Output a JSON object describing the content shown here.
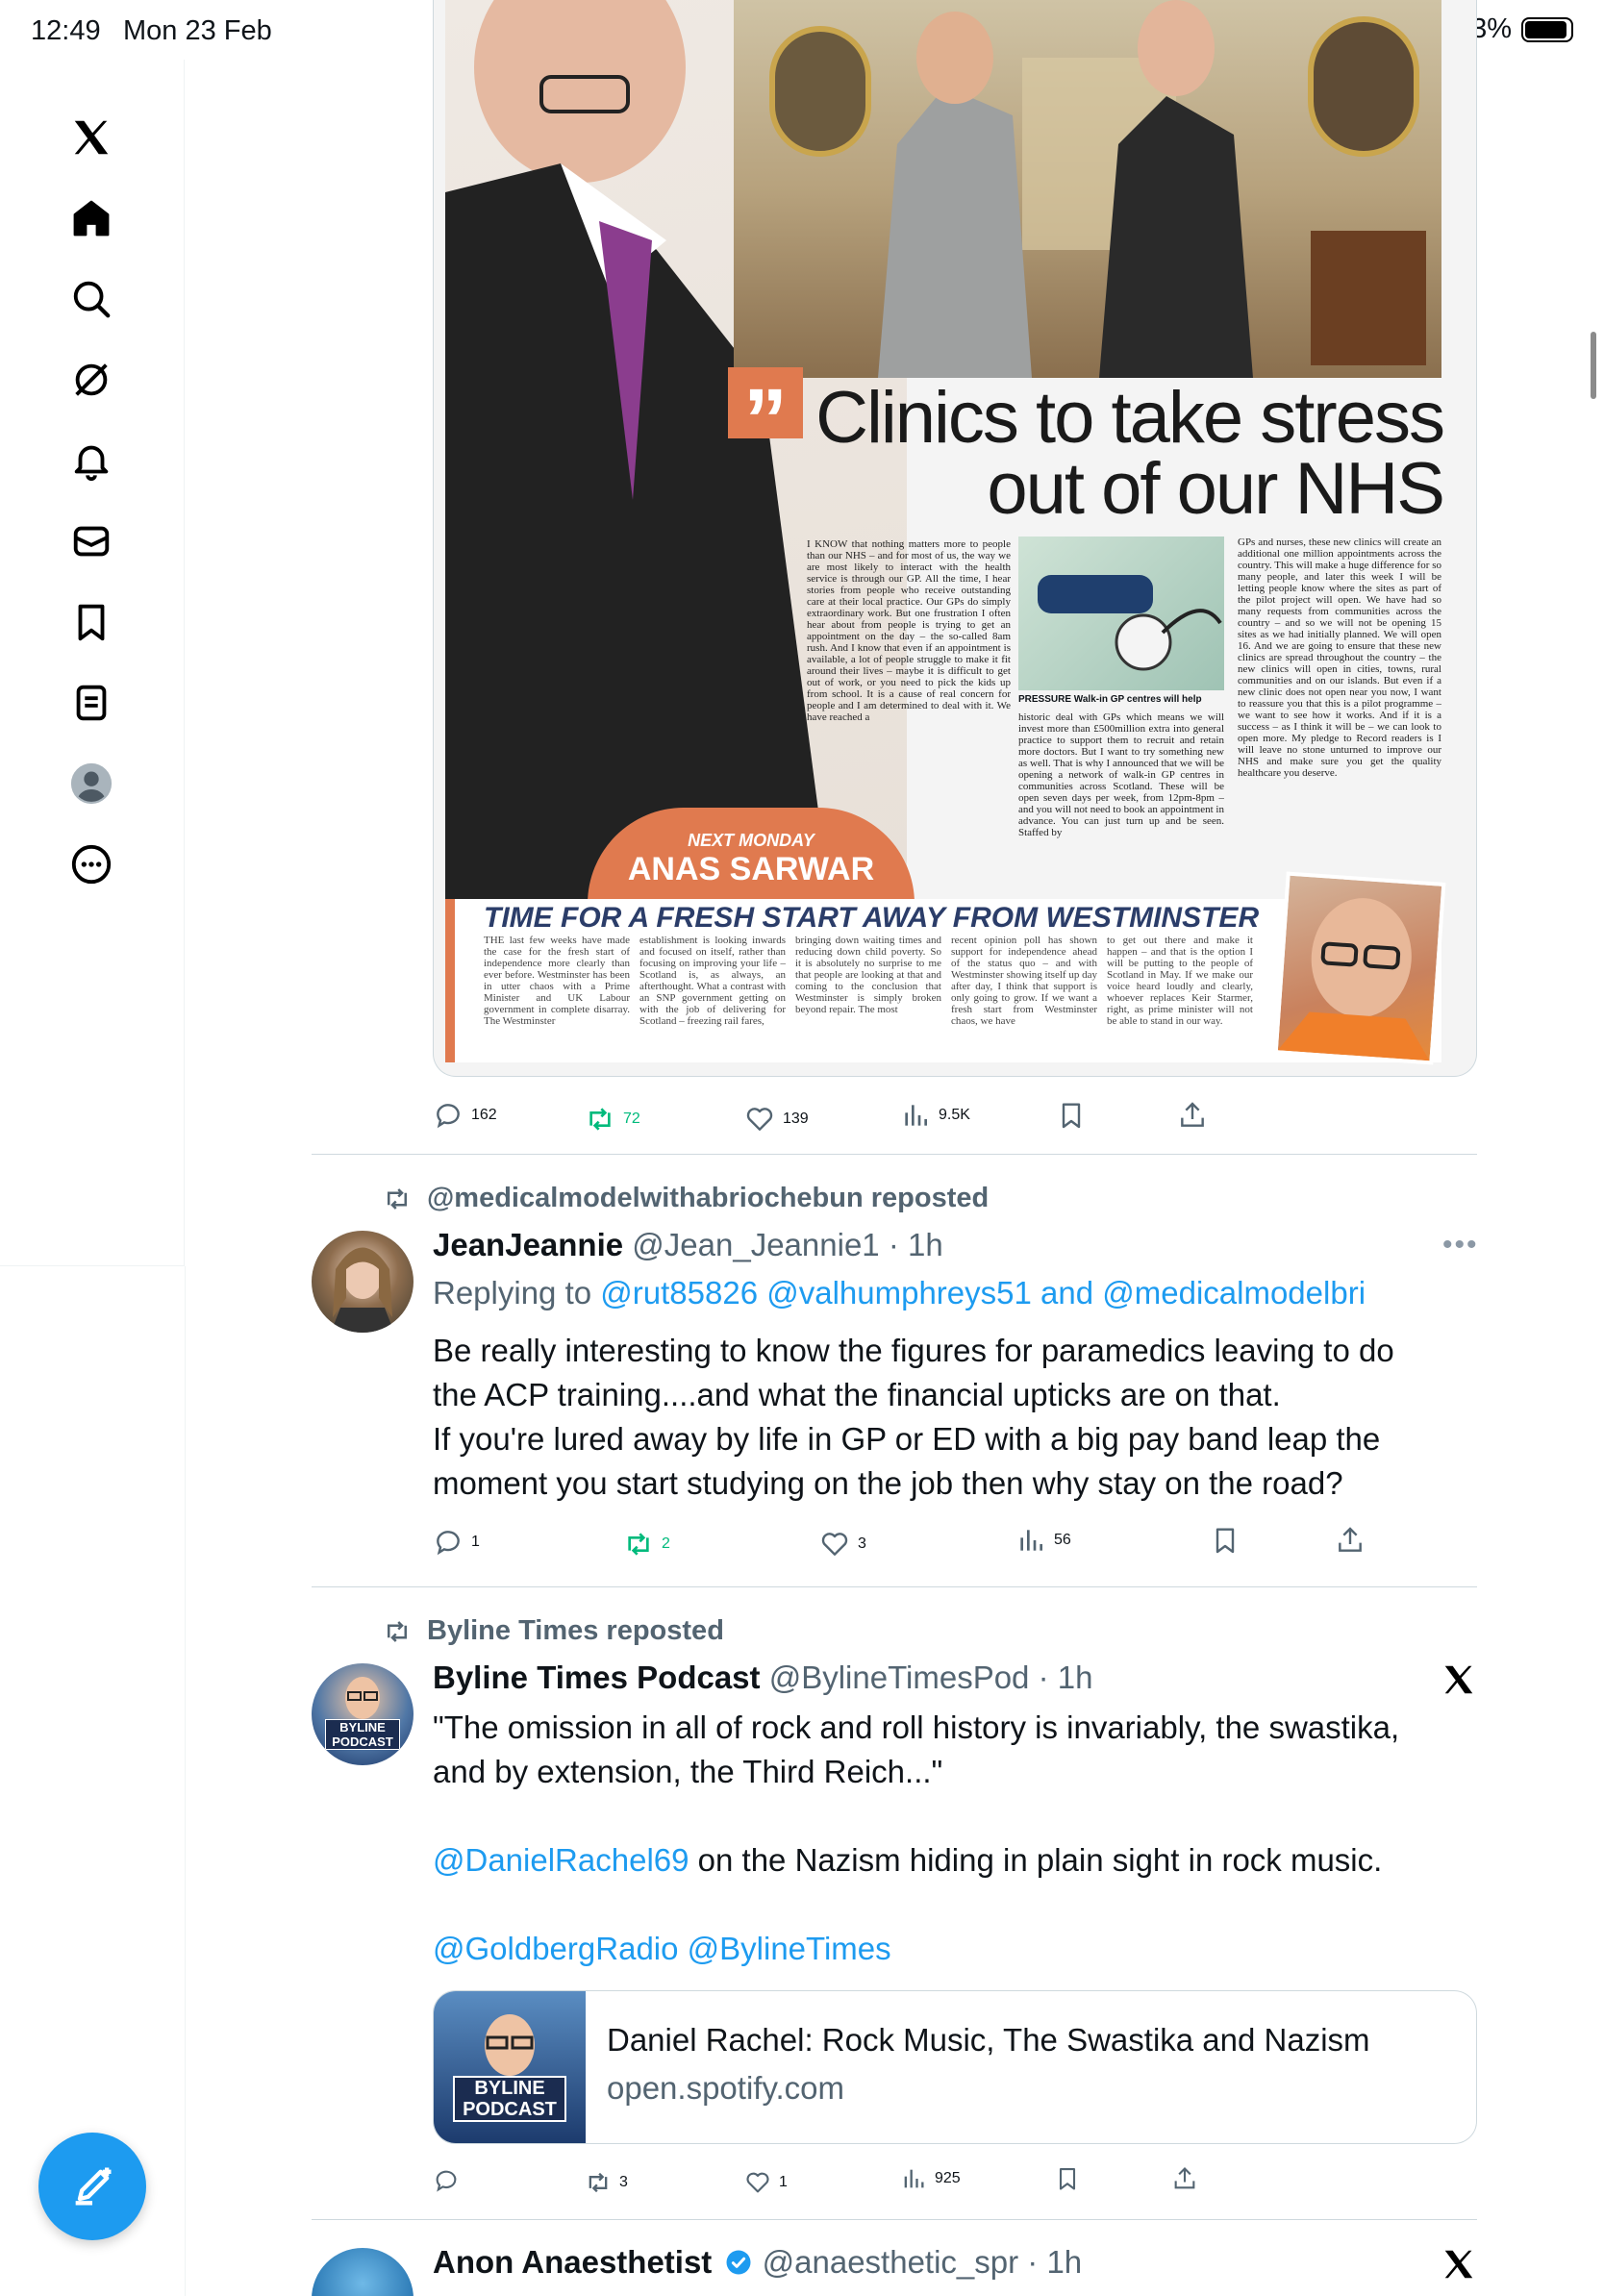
{
  "status_bar": {
    "time": "12:49",
    "date": "Mon 23 Feb",
    "battery": "93%"
  },
  "sidebar": {
    "items": [
      "x-logo",
      "home",
      "explore",
      "grok",
      "notifications",
      "messages",
      "bookmarks",
      "lists",
      "profile",
      "more"
    ]
  },
  "newspaper": {
    "headline_line1": "Clinics to take stress",
    "headline_line2": "out of our NHS",
    "quote_mark": "”",
    "caption": "PRESSURE Walk-in GP centres will help",
    "next_monday_label": "NEXT MONDAY",
    "next_monday_name": "ANAS SARWAR",
    "band_title": "TIME FOR A FRESH START AWAY FROM WESTMINSTER",
    "col1": "I KNOW that nothing matters more to people than our NHS – and for most of us, the way we are most likely to interact with the health service is through our GP. All the time, I hear stories from people who receive outstanding care at their local practice. Our GPs do simply extraordinary work. But one frustration I often hear about from people is trying to get an appointment on the day – the so-called 8am rush. And I know that even if an appointment is available, a lot of people struggle to make it fit around their lives – maybe it is difficult to get out of work, or you need to pick the kids up from school. It is a cause of real concern for people and I am determined to deal with it. We have reached a",
    "col2": "historic deal with GPs which means we will invest more than £500million extra into general practice to support them to recruit and retain more doctors. But I want to try something new as well. That is why I announced that we will be opening a network of walk-in GP centres in communities across Scotland. These will be open seven days per week, from 12pm-8pm – and you will not need to book an appointment in advance. You can just turn up and be seen. Staffed by",
    "col3": "GPs and nurses, these new clinics will create an additional one million appointments across the country. This will make a huge difference for so many people, and later this week I will be letting people know where the sites as part of the pilot project will open. We have had so many requests from communities across the country – and so we will not be opening 15 sites as we had initially planned. We will open 16. And we are going to ensure that these new clinics are spread throughout the country – the new clinics will open in cities, towns, rural communities and on our islands. But even if a new clinic does not open near you now, I want to reassure you that this is a pilot programme – we want to see how it works. And if it is a success – as I think it will be – we can look to open more. My pledge to Record readers is I will leave no stone unturned to improve our NHS and make sure you get the quality healthcare you deserve.",
    "band_cols": [
      "THE last few weeks have made the case for the fresh start of independence more clearly than ever before. Westminster has been in utter chaos with a Prime Minister and UK Labour government in complete disarray. The Westminster",
      "establishment is looking inwards and focused on itself, rather than focusing on improving your life – Scotland is, as always, an afterthought. What a contrast with an SNP government getting on with the job of delivering for Scotland – freezing rail fares,",
      "bringing down waiting times and reducing down child poverty. So it is absolutely no surprise to me that people are looking at that and coming to the conclusion that Westminster is simply broken beyond repair. The most",
      "recent opinion poll has shown support for independence ahead of the status quo – and with Westminster showing itself up day after day, I think that support is only going to grow. If we want a fresh start from Westminster chaos, we have",
      "to get out there and make it happen – and that is the option I will be putting to the people of Scotland in May. If we make our voice heard loudly and clearly, whoever replaces Keir Starmer, right, as prime minister will not be able to stand in our way."
    ]
  },
  "post1_actions": {
    "replies": "162",
    "reposts": "72",
    "likes": "139",
    "views": "9.5K"
  },
  "post2": {
    "repost_by": "@medicalmodelwithabriochebun reposted",
    "name": "JeanJeannie",
    "handle_time": "@Jean_Jeannie1 · 1h",
    "replying_prefix": "Replying to",
    "replying_to": "@rut85826 @valhumphreys51 and @medicalmodelbri",
    "text_lines": [
      "Be really interesting to know the figures for paramedics leaving to do",
      "the ACP training....and what the financial upticks are on that.",
      "If you're lured away by life in GP or ED with a big pay band leap the",
      "moment you start studying on the job then why stay on the road?"
    ],
    "actions": {
      "replies": "1",
      "reposts": "2",
      "likes": "3",
      "views": "56"
    }
  },
  "post3": {
    "repost_by": "Byline Times reposted",
    "name": "Byline Times Podcast",
    "handle_time": "@BylineTimesPod · 1h",
    "avatar_label": "BYLINE PODCAST",
    "text_line1": "\"The omission in all of rock and roll history is invariably, the swastika,",
    "text_line2": "and by extension, the Third Reich...\"",
    "mention1": "@DanielRachel69",
    "text_after_mention": " on the Nazism hiding in plain sight in rock music.",
    "mentions2": "@GoldbergRadio @BylineTimes",
    "card": {
      "title": "Daniel Rachel: Rock Music, The Swastika and Nazism",
      "domain": "open.spotify.com",
      "thumb_label": "BYLINE PODCAST"
    },
    "actions": {
      "replies": "",
      "reposts": "3",
      "likes": "1",
      "views": "925"
    }
  },
  "post4": {
    "name": "Anon Anaesthetist",
    "handle_time": "@anaesthetic_spr · 1h"
  },
  "colors": {
    "accent": "#1d9bf0",
    "repost_green": "#00ba7c",
    "muted": "#536471"
  }
}
